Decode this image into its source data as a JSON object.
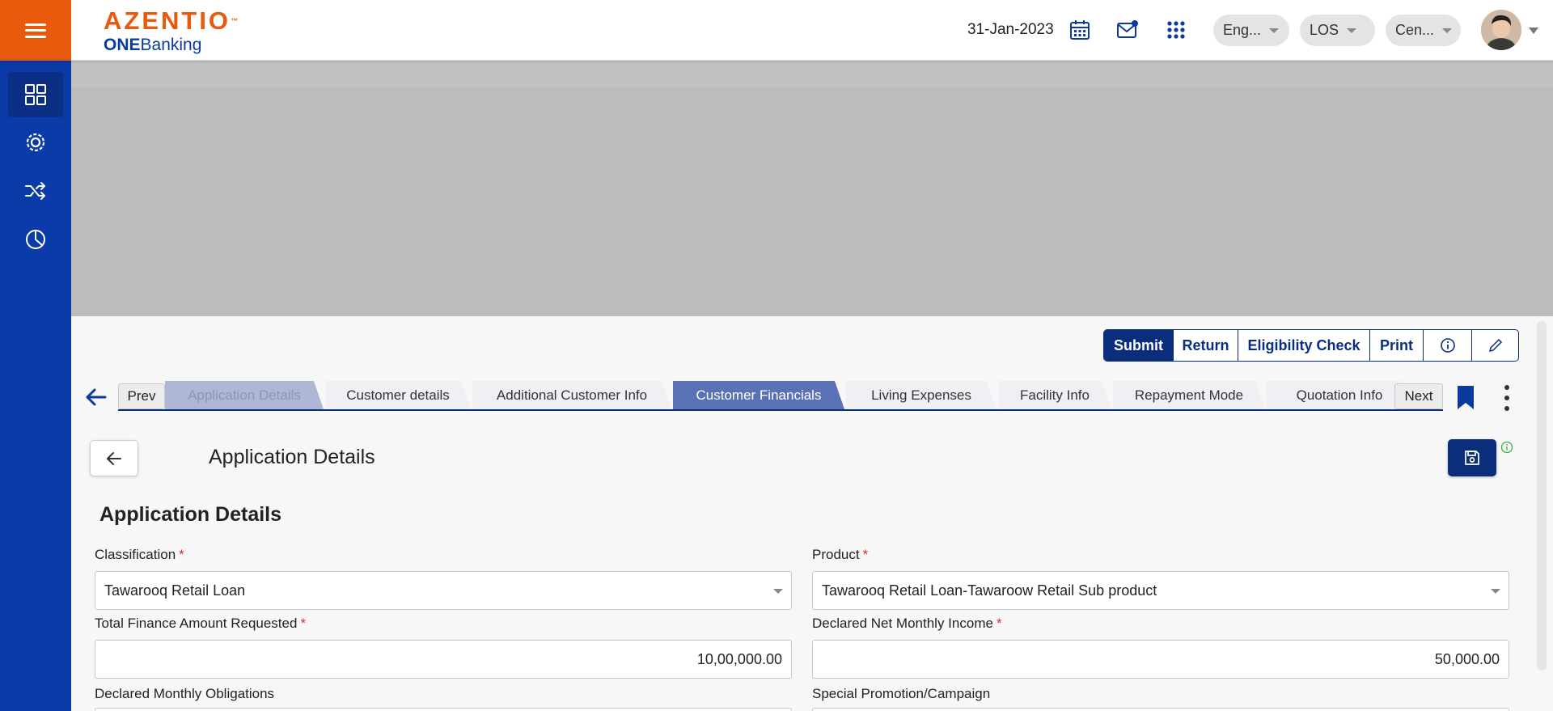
{
  "header": {
    "brand": "AZENTIO",
    "brand_mark": "™",
    "sub_brand_bold": "ONE",
    "sub_brand_rest": "Banking",
    "date": "31-Jan-2023",
    "language": "Eng...",
    "module": "LOS",
    "branch": "Cen...",
    "icons": [
      "menu-icon",
      "calendar-icon",
      "mail-icon",
      "apps-grid-icon",
      "avatar"
    ]
  },
  "sidebar": {
    "items": [
      {
        "icon": "dashboard-grid-icon"
      },
      {
        "icon": "settings-gear-icon"
      },
      {
        "icon": "shuffle-icon"
      },
      {
        "icon": "pie-chart-icon"
      }
    ]
  },
  "actions": {
    "submit": "Submit",
    "return": "Return",
    "eligibility": "Eligibility Check",
    "print": "Print",
    "info_icon": "info-icon",
    "edit_icon": "edit-pencil-icon"
  },
  "tabs": {
    "prev": "Prev",
    "next": "Next",
    "items": [
      {
        "label": "Application Details"
      },
      {
        "label": "Customer details"
      },
      {
        "label": "Additional Customer Info"
      },
      {
        "label": "Customer Financials"
      },
      {
        "label": "Living Expenses"
      },
      {
        "label": "Facility Info"
      },
      {
        "label": "Repayment Mode"
      },
      {
        "label": "Quotation Info"
      }
    ]
  },
  "page": {
    "title": "Application Details",
    "section_title": "Application Details"
  },
  "form": {
    "classification_label": "Classification",
    "classification_value": "Tawarooq Retail Loan",
    "product_label": "Product",
    "product_value": "Tawarooq Retail Loan-Tawaroow Retail Sub product",
    "finance_amount_label": "Total Finance Amount Requested",
    "finance_amount_value": "10,00,000.00",
    "net_income_label": "Declared Net Monthly Income",
    "net_income_value": "50,000.00",
    "obligations_label": "Declared Monthly Obligations",
    "promotion_label": "Special Promotion/Campaign",
    "required_mark": "*"
  },
  "colors": {
    "accent_orange": "#e8590c",
    "primary_blue": "#0a2d7c",
    "sidebar_blue": "#0a3ba8",
    "tab_current": "#5a72b5"
  }
}
